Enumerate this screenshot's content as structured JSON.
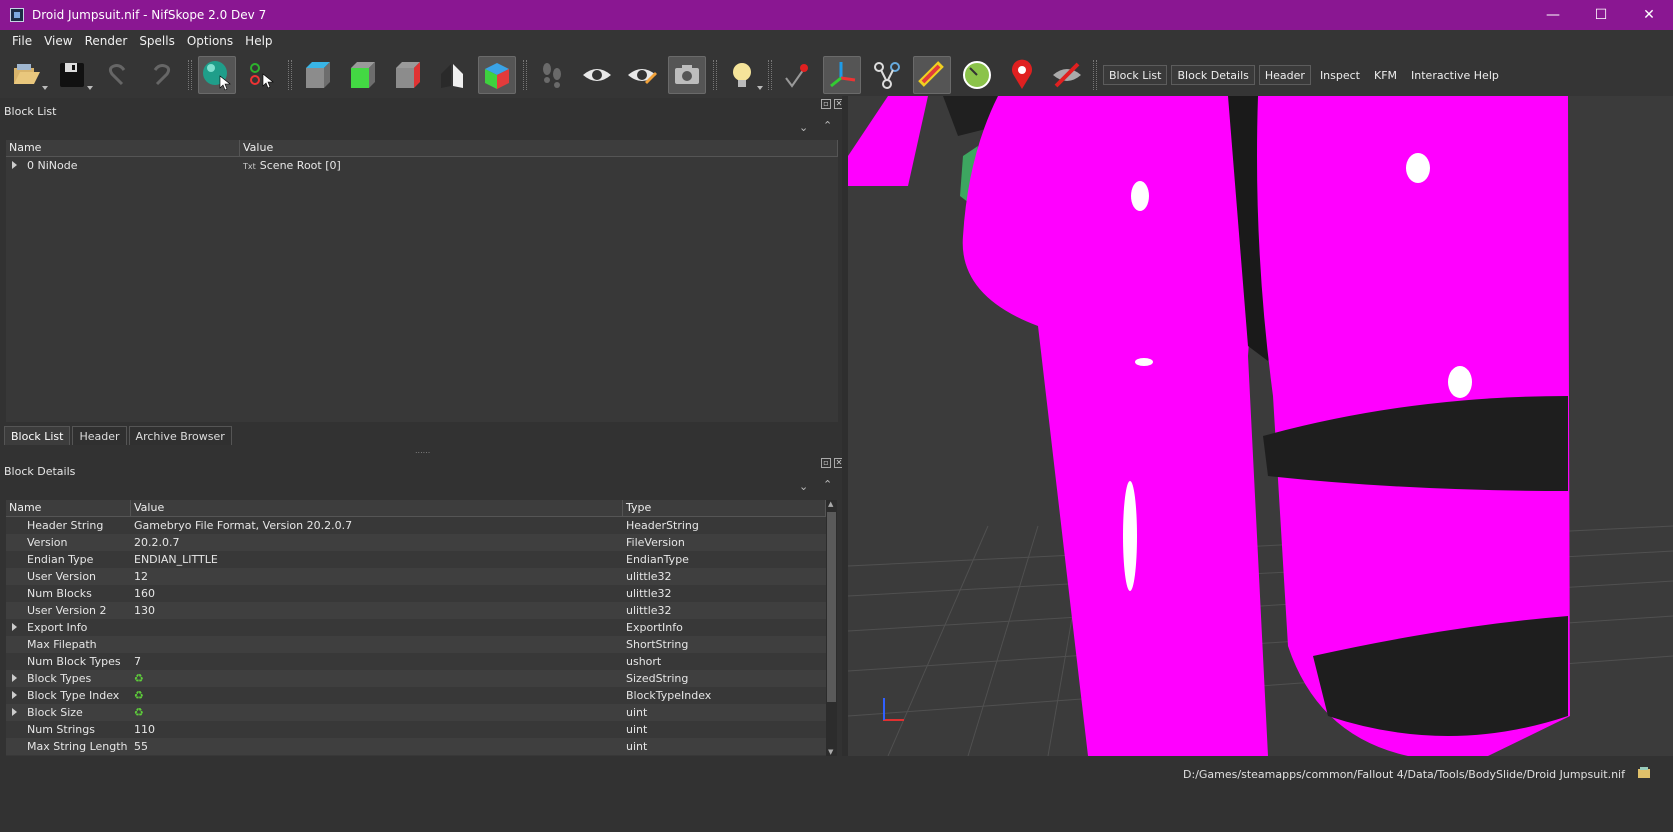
{
  "window": {
    "title": "Droid Jumpsuit.nif - NifSkope 2.0 Dev 7",
    "minimize": "—",
    "maximize": "☐",
    "close": "✕"
  },
  "menu": [
    "File",
    "View",
    "Render",
    "Spells",
    "Options",
    "Help"
  ],
  "toolbar_links": [
    "Block List",
    "Block Details",
    "Header",
    "Inspect",
    "KFM",
    "Interactive Help"
  ],
  "block_list": {
    "title": "Block List",
    "columns": [
      "Name",
      "Value"
    ],
    "rows": [
      {
        "name": "0 NiNode",
        "value": "Scene Root [0]"
      }
    ]
  },
  "bottom_tabs": [
    "Block List",
    "Header",
    "Archive Browser"
  ],
  "block_details": {
    "title": "Block Details",
    "columns": [
      "Name",
      "Value",
      "Type"
    ],
    "rows": [
      {
        "name": "Header String",
        "value": "Gamebryo File Format, Version 20.2.0.7",
        "type": "HeaderString",
        "expandable": false
      },
      {
        "name": "Version",
        "value": "20.2.0.7",
        "type": "FileVersion",
        "expandable": false
      },
      {
        "name": "Endian Type",
        "value": "ENDIAN_LITTLE",
        "type": "EndianType",
        "expandable": false
      },
      {
        "name": "User Version",
        "value": "12",
        "type": "ulittle32",
        "expandable": false
      },
      {
        "name": "Num Blocks",
        "value": "160",
        "type": "ulittle32",
        "expandable": false
      },
      {
        "name": "User Version 2",
        "value": "130",
        "type": "ulittle32",
        "expandable": false
      },
      {
        "name": "Export Info",
        "value": "",
        "type": "ExportInfo",
        "expandable": true
      },
      {
        "name": "Max Filepath",
        "value": "",
        "type": "ShortString",
        "expandable": false
      },
      {
        "name": "Num Block Types",
        "value": "7",
        "type": "ushort",
        "expandable": false
      },
      {
        "name": "Block Types",
        "value": "",
        "type": "SizedString",
        "expandable": true,
        "icon": true
      },
      {
        "name": "Block Type Index",
        "value": "",
        "type": "BlockTypeIndex",
        "expandable": true,
        "icon": true
      },
      {
        "name": "Block Size",
        "value": "",
        "type": "uint",
        "expandable": true,
        "icon": true
      },
      {
        "name": "Num Strings",
        "value": "110",
        "type": "uint",
        "expandable": false
      },
      {
        "name": "Max String Length",
        "value": "55",
        "type": "uint",
        "expandable": false
      }
    ]
  },
  "status": {
    "path": "D:/Games/steamapps/common/Fallout 4/Data/Tools/BodySlide/Droid Jumpsuit.nif"
  },
  "colors": {
    "title_bar": "#8a1792",
    "mesh": "#ff00ff"
  }
}
